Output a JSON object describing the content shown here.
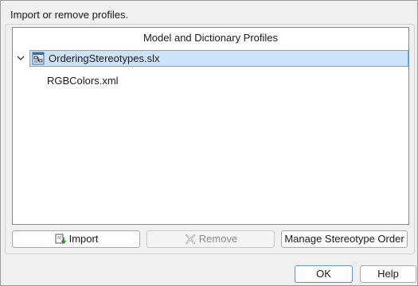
{
  "dialog": {
    "instruction": "Import or remove profiles."
  },
  "profiles_tree": {
    "header": "Model and Dictionary Profiles",
    "items": [
      {
        "label": "OrderingStereotypes.slx",
        "icon": "simulink-model-icon",
        "expanded": true,
        "selected": true,
        "children": [
          {
            "label": "RGBColors.xml"
          }
        ]
      }
    ]
  },
  "actions": {
    "import_label": "Import",
    "import_icon": "import-icon",
    "remove_label": "Remove",
    "remove_icon": "remove-x-icon",
    "remove_enabled": false,
    "manage_label": "Manage Stereotype Order"
  },
  "footer": {
    "ok_label": "OK",
    "help_label": "Help"
  },
  "colors": {
    "selection_fill": "#cde3fa",
    "selection_border": "#6aa7e6",
    "disabled_text": "#8c8c8c"
  }
}
